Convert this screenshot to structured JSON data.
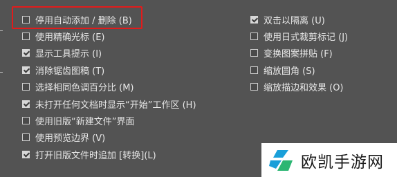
{
  "left_options": [
    {
      "label": "停用自动添加 / 删除 (B)",
      "checked": false
    },
    {
      "label": "使用精确光标 (E)",
      "checked": false
    },
    {
      "label": "显示工具提示 (I)",
      "checked": true
    },
    {
      "label": "消除锯齿图稿 (T)",
      "checked": true
    },
    {
      "label": "选择相同色调百分比 (M)",
      "checked": false
    },
    {
      "label": "未打开任何文档时显示“开始”工作区 (H)",
      "checked": true
    },
    {
      "label": "使用旧版“新建文件”界面",
      "checked": false
    },
    {
      "label": "使用预览边界 (V)",
      "checked": false
    },
    {
      "label": "打开旧版文件时追加 [转换](L)",
      "checked": true
    }
  ],
  "right_options": [
    {
      "label": "双击以隔离 (U)",
      "checked": true
    },
    {
      "label": "使用日式裁剪标记 (J)",
      "checked": false
    },
    {
      "label": "变换图案拼贴 (F)",
      "checked": false
    },
    {
      "label": "缩放圆角 (S)",
      "checked": false
    },
    {
      "label": "缩放描边和效果 (O)",
      "checked": false
    }
  ],
  "watermark": {
    "text": "欧凯手游网",
    "accent": "#1a9fd9",
    "accent2": "#2bb673"
  },
  "colors": {
    "bg": "#535353",
    "highlight": "#e21b1b"
  }
}
